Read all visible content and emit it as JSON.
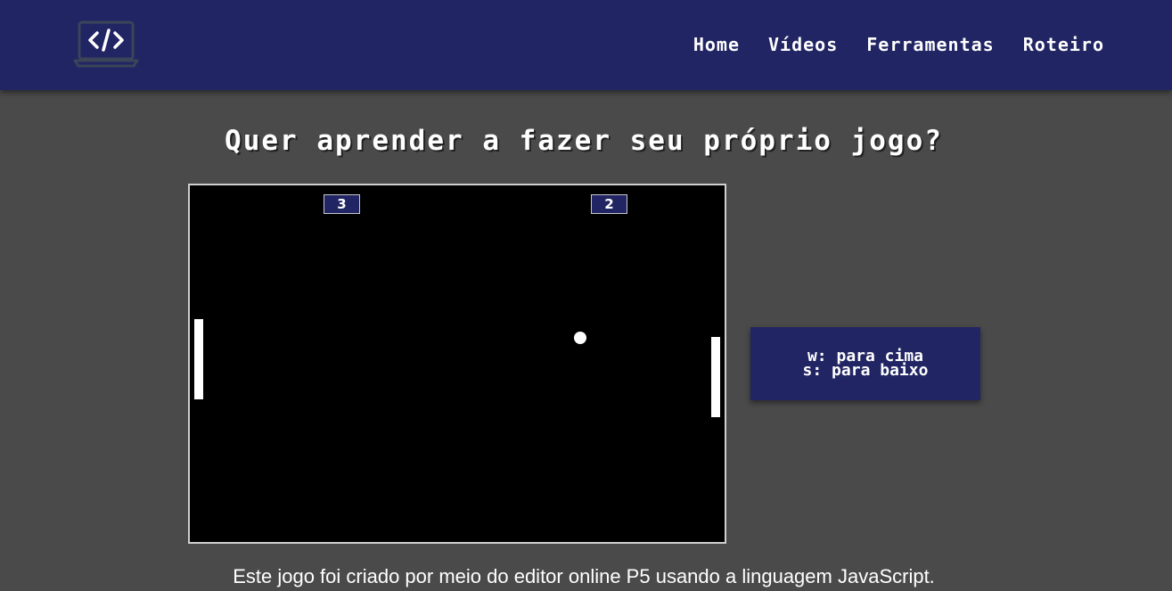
{
  "header": {
    "logo_icon": "laptop-code-icon",
    "nav": [
      "Home",
      "Vídeos",
      "Ferramentas",
      "Roteiro"
    ]
  },
  "main": {
    "headline": "Quer aprender a fazer seu próprio jogo?",
    "game": {
      "score_left": "3",
      "score_right": "2"
    },
    "controls": {
      "up": "w: para cima",
      "down": "s: para baixo"
    },
    "caption": "Este jogo foi criado por meio do editor online P5 usando a linguagem JavaScript."
  },
  "colors": {
    "header_bg": "#212563",
    "page_bg": "#4a4a4a",
    "game_bg": "#000000"
  }
}
